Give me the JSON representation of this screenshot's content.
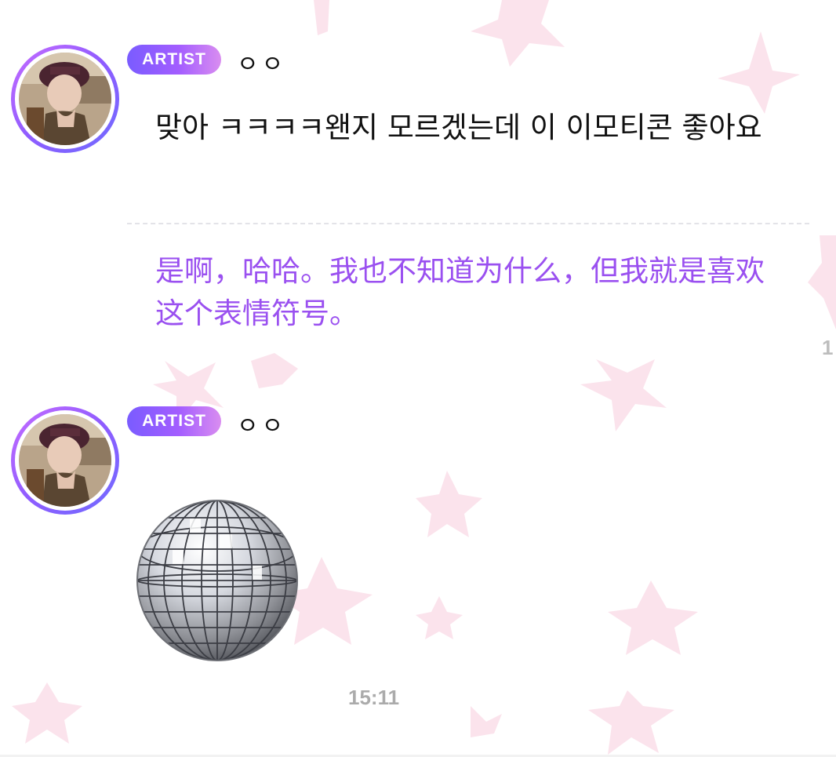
{
  "messages": [
    {
      "badge": "ARTIST",
      "sender": "ㅇㅇ",
      "text": "맞아 ㅋㅋㅋㅋ왠지 모르겠는데 이 이모티콘 좋아요",
      "translation": "是啊，哈哈。我也不知道为什么，但我就是喜欢这个表情符号。",
      "time_partial": "1"
    },
    {
      "badge": "ARTIST",
      "sender": "ㅇㅇ",
      "emoticon": "disco-ball",
      "time": "15:11"
    }
  ],
  "colors": {
    "badge_start": "#7a5cff",
    "badge_end": "#d98df0",
    "translation_text": "#9a50f0",
    "timestamp": "#ababab",
    "background_stars": "#fbe3ec"
  }
}
